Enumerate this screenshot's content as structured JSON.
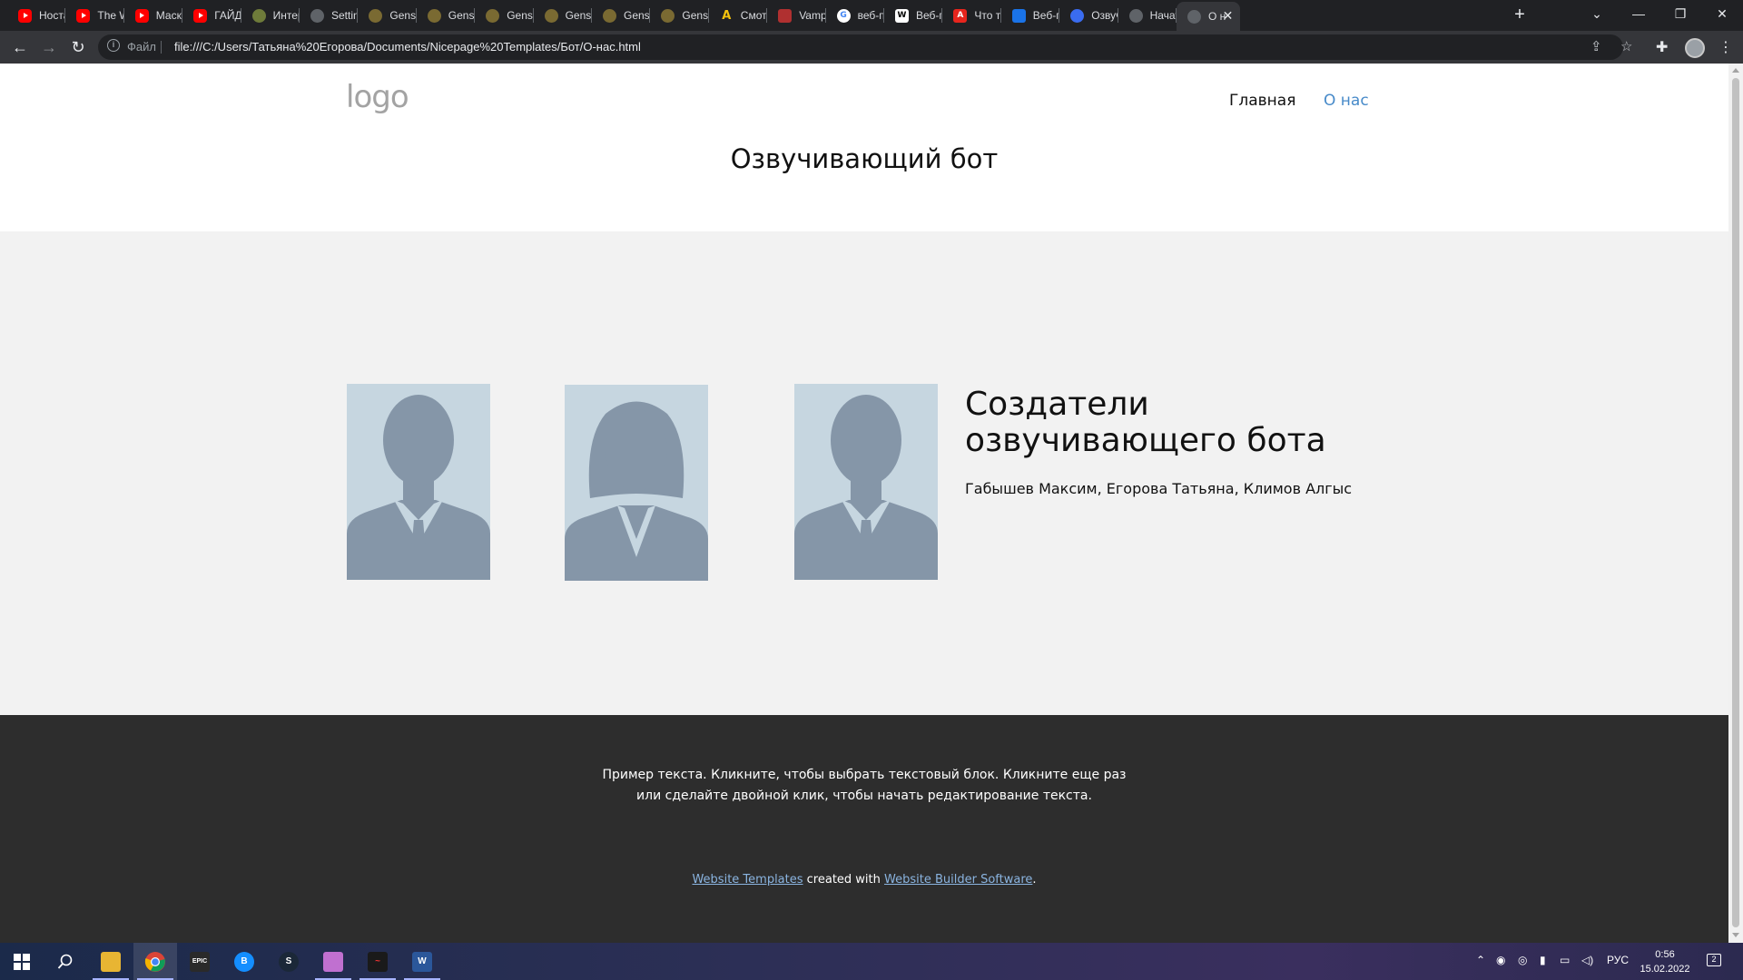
{
  "browser": {
    "tabs": [
      {
        "label": "Ностал",
        "icon": "youtube-icon",
        "fav": "yt"
      },
      {
        "label": "The Wi",
        "icon": "youtube-icon",
        "fav": "yt"
      },
      {
        "label": "Маска",
        "icon": "youtube-icon",
        "fav": "yt"
      },
      {
        "label": "ГАЙД !",
        "icon": "youtube-icon",
        "fav": "yt"
      },
      {
        "label": "Интер",
        "icon": "site-icon",
        "fav": "green"
      },
      {
        "label": "Setting",
        "icon": "site-icon",
        "fav": "gray"
      },
      {
        "label": "Genshi",
        "icon": "genshin-icon",
        "fav": "gold"
      },
      {
        "label": "Genshi",
        "icon": "genshin-icon",
        "fav": "gold"
      },
      {
        "label": "Genshi",
        "icon": "genshin-icon",
        "fav": "gold"
      },
      {
        "label": "Genshi",
        "icon": "genshin-icon",
        "fav": "gold"
      },
      {
        "label": "Genshi",
        "icon": "genshin-icon",
        "fav": "gold"
      },
      {
        "label": "Genshi",
        "icon": "genshin-icon",
        "fav": "gold"
      },
      {
        "label": "Смотр",
        "icon": "anime-icon",
        "fav": "yel"
      },
      {
        "label": "Vampi",
        "icon": "vampire-icon",
        "fav": "red2"
      },
      {
        "label": "веб-пр",
        "icon": "google-icon",
        "fav": "google"
      },
      {
        "label": "Веб-пр",
        "icon": "wikipedia-icon",
        "fav": "wiki"
      },
      {
        "label": "Что та",
        "icon": "adobe-icon",
        "fav": "adobe"
      },
      {
        "label": "Веб-пр",
        "icon": "site-icon",
        "fav": "blue"
      },
      {
        "label": "Озвуч",
        "icon": "site-icon",
        "fav": "bluecirc"
      },
      {
        "label": "Начать",
        "icon": "globe-icon",
        "fav": "gray"
      },
      {
        "label": "О н",
        "icon": "globe-icon",
        "fav": "gray",
        "active": true
      }
    ],
    "omnibox": {
      "scheme_label": "Файл",
      "url": "file:///C:/Users/Татьяна%20Егорова/Documents/Nicepage%20Templates/Бот/О-нас.html"
    }
  },
  "site": {
    "logo": "logo",
    "nav": {
      "home": "Главная",
      "about": "О нас"
    },
    "title": "Озвучивающий бот",
    "team": {
      "heading": "Создатели озвучивающего бота",
      "names": "Габышев Максим, Егорова Татьяна, Климов Алгыс"
    },
    "footer": {
      "text": "Пример текста. Кликните, чтобы выбрать текстовый блок. Кликните еще раз или сделайте двойной клик, чтобы начать редактирование текста.",
      "credit_link1": "Website Templates",
      "credit_mid": " created with ",
      "credit_link2": "Website Builder Software",
      "credit_end": "."
    }
  },
  "taskbar": {
    "language": "РУС",
    "time": "0:56",
    "date": "15.02.2022",
    "notifications": "2"
  }
}
